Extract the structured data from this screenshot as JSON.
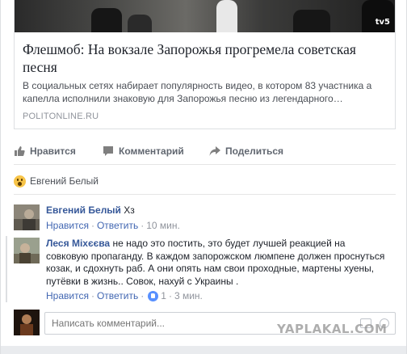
{
  "preview": {
    "title": "Флешмоб: На вокзале Запорожья прогремела советская песня",
    "description": "В социальных сетях набирает популярность видео, в котором 83 участника а капелла исполнили знаковую для Запорожья песню из легендарного…",
    "source": "POLITONLINE.RU",
    "thumb_badge": "tv5"
  },
  "actions": {
    "like": "Нравится",
    "comment": "Комментарий",
    "share": "Поделиться"
  },
  "reactions": {
    "icon": "wow-reaction-icon",
    "names": "Евгений Белый"
  },
  "comments": [
    {
      "author": "Евгений Белый",
      "text": " Хз",
      "like": "Нравится",
      "reply": "Ответить",
      "time": "10 мин."
    },
    {
      "author": "Леся Міхєєва",
      "text": " не надо это постить, это будет лучшей реакцией на совковую пропаганду. В каждом запорожском люмпене должен проснуться козак, и сдохнуть раб. А они опять нам свои проходные, мартены хуены, путёвки в жизнь.. Совок, нахуй с Украины .",
      "like": "Нравится",
      "reply": "Ответить",
      "likes_count": "1",
      "time": "3 мин."
    }
  ],
  "composer": {
    "placeholder": "Написать комментарий..."
  },
  "watermark": "YAPLAKAL.COM",
  "colors": {
    "link": "#365899",
    "meta_link": "#4267b2",
    "like_blue": "#5890ff",
    "muted": "#90949c"
  }
}
